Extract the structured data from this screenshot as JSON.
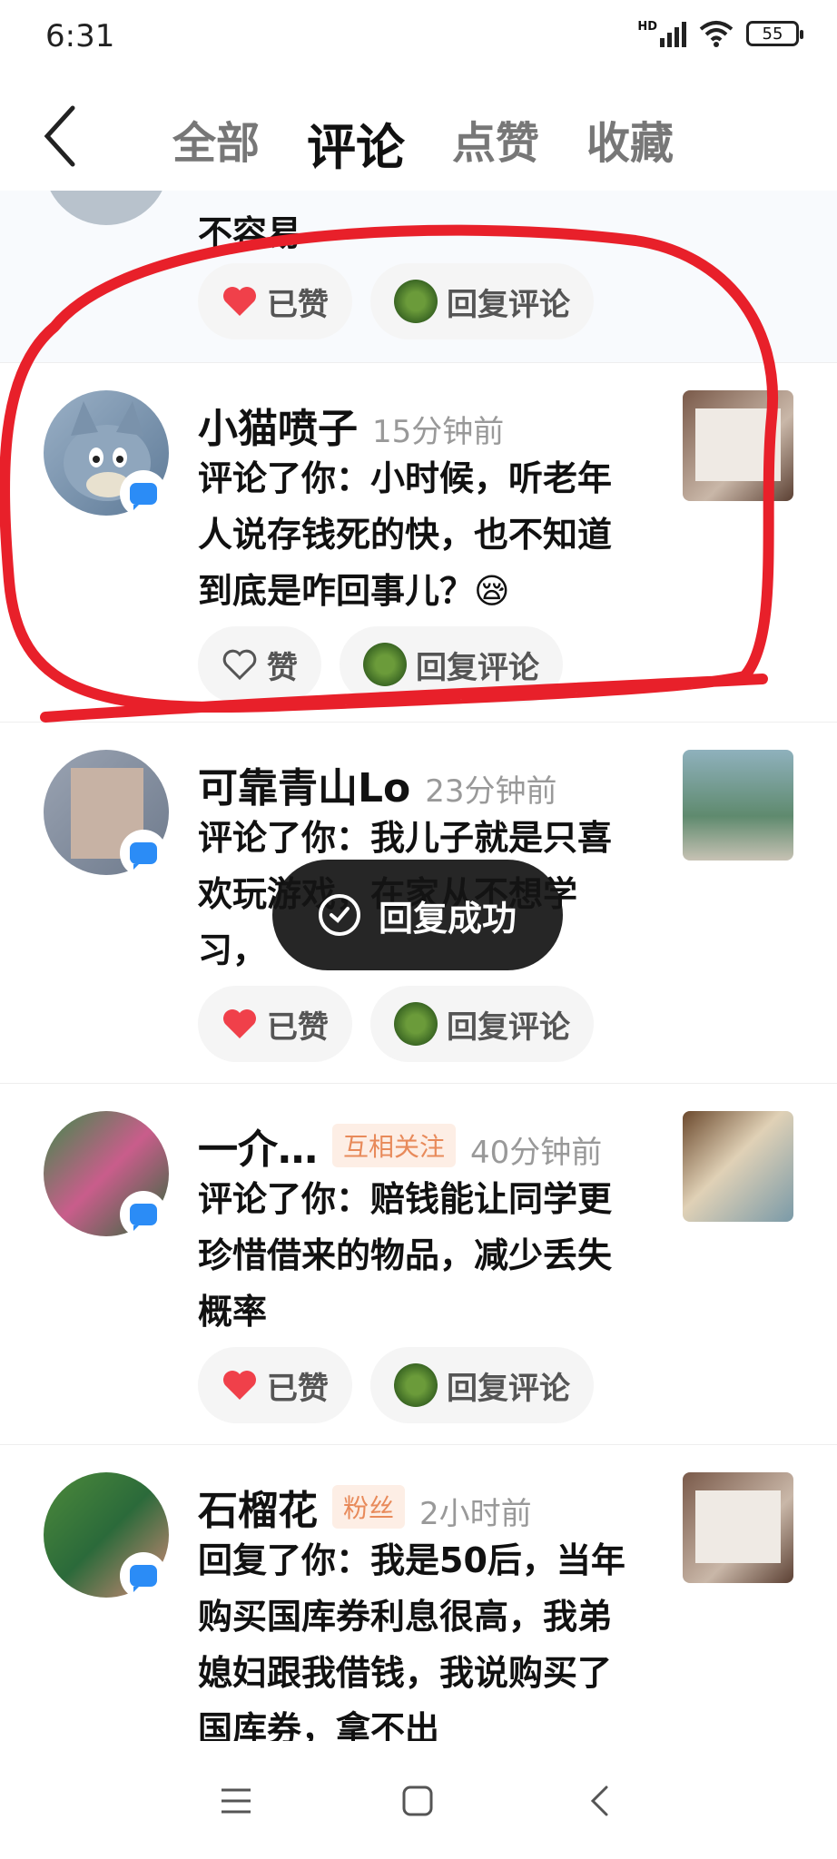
{
  "status_bar": {
    "time": "6:31",
    "network": "HD",
    "battery": "55"
  },
  "header": {
    "tabs": [
      {
        "label": "全部",
        "active": false
      },
      {
        "label": "评论",
        "active": true
      },
      {
        "label": "点赞",
        "active": false
      },
      {
        "label": "收藏",
        "active": false
      }
    ]
  },
  "feed": {
    "top_partial": {
      "comment_tail": "不容易",
      "like_label": "已赞",
      "reply_label": "回复评论"
    },
    "items": [
      {
        "name": "小猫喷子",
        "time": "15分钟前",
        "comment": "评论了你：小时候，听老年人说存钱死的快，也不知道到底是咋回事儿？😪",
        "like_label": "赞",
        "liked": false,
        "reply_label": "回复评论"
      },
      {
        "name": "可靠青山Lo",
        "time": "23分钟前",
        "comment": "评论了你：我儿子就是只喜欢玩游戏，在家从不想学习，",
        "like_label": "已赞",
        "liked": true,
        "reply_label": "回复评论"
      },
      {
        "name": "一介…",
        "tag": "互相关注",
        "time": "40分钟前",
        "comment": "评论了你：赔钱能让同学更珍惜借来的物品，减少丢失概率",
        "like_label": "已赞",
        "liked": true,
        "reply_label": "回复评论"
      },
      {
        "name": "石榴花",
        "tag": "粉丝",
        "time": "2小时前",
        "comment": "回复了你：我是50后，当年购买国库券利息很高，我弟媳妇跟我借钱，我说购买了国库券，拿不出",
        "like_label": "",
        "liked": false,
        "reply_label": ""
      }
    ]
  },
  "toast": {
    "label": "回复成功"
  },
  "colors": {
    "like_red": "#f0404a",
    "annotation_red": "#e8202a",
    "badge_blue": "#2b8cf6"
  }
}
